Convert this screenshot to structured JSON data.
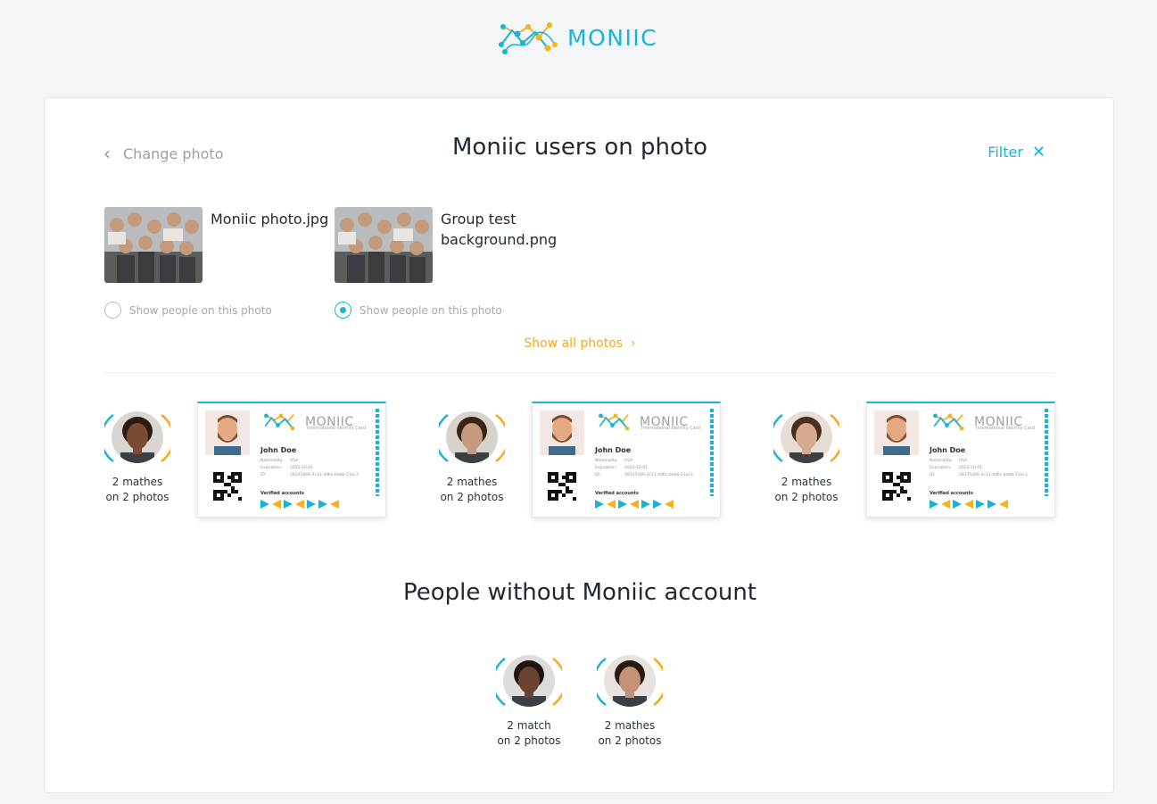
{
  "app": {
    "name": "MONIIC"
  },
  "header": {
    "back_label": "Change photo",
    "title": "Moniic users on photo",
    "filter_label": "Filter"
  },
  "photos": [
    {
      "name": "Moniic photo.jpg",
      "radio_label": "Show people on this photo",
      "selected": false
    },
    {
      "name": "Group test background.png",
      "radio_label": "Show people on this photo",
      "selected": true
    }
  ],
  "show_all_label": "Show all photos",
  "users": [
    {
      "matches": "2 mathes",
      "photos": "on 2 photos"
    },
    {
      "matches": "2 mathes",
      "photos": "on 2 photos"
    },
    {
      "matches": "2 mathes",
      "photos": "on 2 photos"
    }
  ],
  "id_card": {
    "brand": "MONIIC",
    "subtitle": "International Identity Card",
    "name": "John Doe",
    "nationality_label": "Nationality:",
    "nationality": "USA",
    "expiration_label": "Expiration:",
    "expiration": "2022-10-01",
    "id_label": "ID:",
    "id": "28135446-3c11-4d6c-bebb-51ec3",
    "verified_label": "Verified accounts"
  },
  "non_users_title": "People without Moniic account",
  "non_users": [
    {
      "matches": "2 match",
      "photos": "on 2 photos"
    },
    {
      "matches": "2 mathes",
      "photos": "on 2 photos"
    }
  ],
  "colors": {
    "accent": "#1ab3d4",
    "orange": "#f5a81c",
    "bg": "#f4f5f7"
  }
}
